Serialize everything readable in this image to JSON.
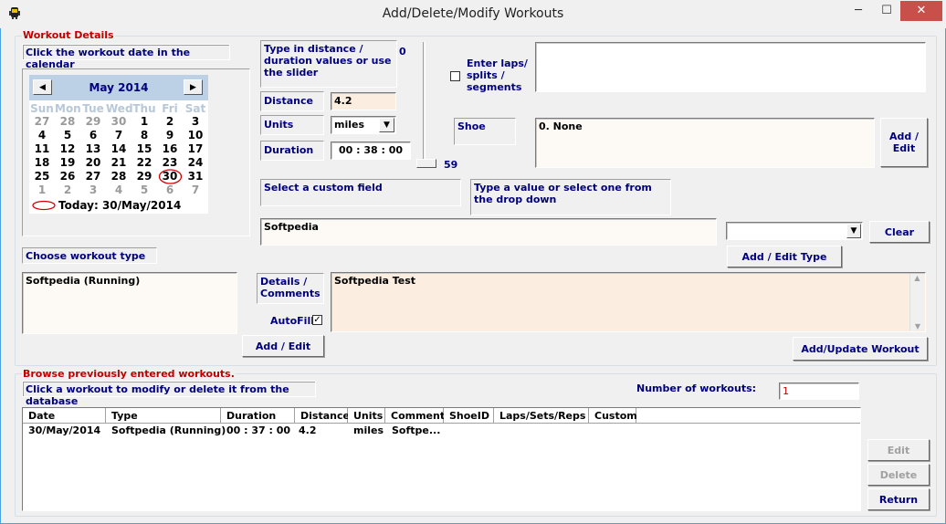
{
  "window": {
    "title": "Add/Delete/Modify Workouts",
    "minimize": "─",
    "maximize": "☐",
    "close": "✕"
  },
  "workout_details": {
    "group_title": "Workout Details",
    "calendar_hint": "Click the workout date in the calendar",
    "calendar": {
      "month_label": "May 2014",
      "prev": "◀",
      "next": "▶",
      "weekdays": [
        "Sun",
        "Mon",
        "Tue",
        "Wed",
        "Thu",
        "Fri",
        "Sat"
      ],
      "weeks": [
        [
          "27",
          "28",
          "29",
          "30",
          "1",
          "2",
          "3"
        ],
        [
          "4",
          "5",
          "6",
          "7",
          "8",
          "9",
          "10"
        ],
        [
          "11",
          "12",
          "13",
          "14",
          "15",
          "16",
          "17"
        ],
        [
          "18",
          "19",
          "20",
          "21",
          "22",
          "23",
          "24"
        ],
        [
          "25",
          "26",
          "27",
          "28",
          "29",
          "30",
          "31"
        ],
        [
          "1",
          "2",
          "3",
          "4",
          "5",
          "6",
          "7"
        ]
      ],
      "today_label": "Today: 30/May/2014"
    },
    "distance_hint": "Type in distance / duration values or use the slider",
    "slider_top_value": "0",
    "slider_bottom_value": "59",
    "distance_label": "Distance",
    "distance_value": "4.2",
    "units_label": "Units",
    "units_value": "miles",
    "duration_label": "Duration",
    "duration_value": "00 : 38 : 00",
    "laps_label": "Enter laps/ splits / segments",
    "laps_value": "",
    "shoe_label": "Shoe",
    "shoe_value": "0. None",
    "add_edit_shoe": "Add / Edit",
    "custom_field_label": "Select a custom field",
    "custom_value_hint": "Type a value or select one from the drop down",
    "custom_field_value": "Softpedia",
    "custom_value_select": "",
    "clear_button": "Clear",
    "add_edit_type_button": "Add / Edit Type",
    "workout_type_label": "Choose workout type",
    "workout_type_value": "Softpedia (Running)",
    "details_label": "Details / Comments",
    "details_value": "Softpedia Test",
    "autofill_label": "AutoFill",
    "autofill_checked": "✓",
    "add_edit_button": "Add / Edit",
    "add_update_button": "Add/Update Workout"
  },
  "browse": {
    "group_title": "Browse previously entered workouts.",
    "hint": "Click a workout to modify or delete it from the database",
    "count_label": "Number of workouts:",
    "count_value": "1",
    "columns": [
      "Date",
      "Type",
      "Duration",
      "Distance",
      "Units",
      "Comment",
      "ShoeID",
      "Laps/Sets/Reps",
      "Custom"
    ],
    "rows": [
      [
        "30/May/2014",
        "Softpedia (Running)",
        "00 : 37 : 00",
        "4.2",
        "miles",
        "Softpe...",
        "",
        "",
        ""
      ]
    ],
    "edit_button": "Edit",
    "delete_button": "Delete",
    "return_button": "Return"
  }
}
